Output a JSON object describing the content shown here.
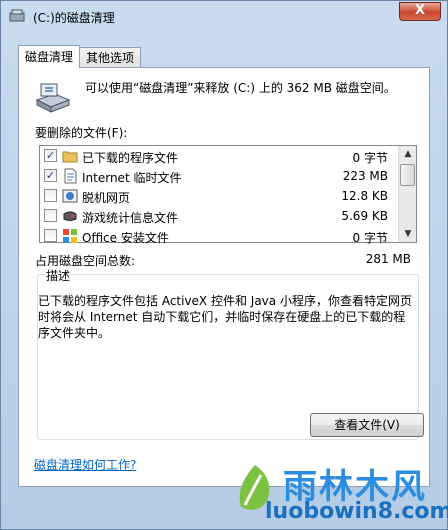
{
  "window": {
    "title": "(C:)的磁盘清理",
    "close_label": "X"
  },
  "tabs": [
    {
      "label": "磁盘清理",
      "active": true
    },
    {
      "label": "其他选项",
      "active": false
    }
  ],
  "header": {
    "text": "可以使用“磁盘清理”来释放 (C:) 上的 362 MB 磁盘空间。"
  },
  "files_label": "要删除的文件(F):",
  "files": [
    {
      "name": "已下载的程序文件",
      "size": "0 字节",
      "checked": true
    },
    {
      "name": "Internet 临时文件",
      "size": "223 MB",
      "checked": true
    },
    {
      "name": "脱机网页",
      "size": "12.8 KB",
      "checked": false
    },
    {
      "name": "游戏统计信息文件",
      "size": "5.69 KB",
      "checked": false
    },
    {
      "name": "Office 安装文件",
      "size": "0 字节",
      "checked": false
    }
  ],
  "total": {
    "label": "占用磁盘空间总数:",
    "value": "281 MB"
  },
  "description": {
    "title": "描述",
    "text": "已下载的程序文件包括 ActiveX 控件和 Java 小程序，你查看特定网页时将会从 Internet 自动下载它们，并临时保存在硬盘上的已下载的程序文件夹中。"
  },
  "view_button": "查看文件(V)",
  "help_link": "磁盘清理如何工作?",
  "watermark": {
    "title": "雨林木风",
    "url": "luobowin8.com"
  },
  "colors": {
    "link": "#0066cc",
    "watermark": "#2a8de0"
  }
}
